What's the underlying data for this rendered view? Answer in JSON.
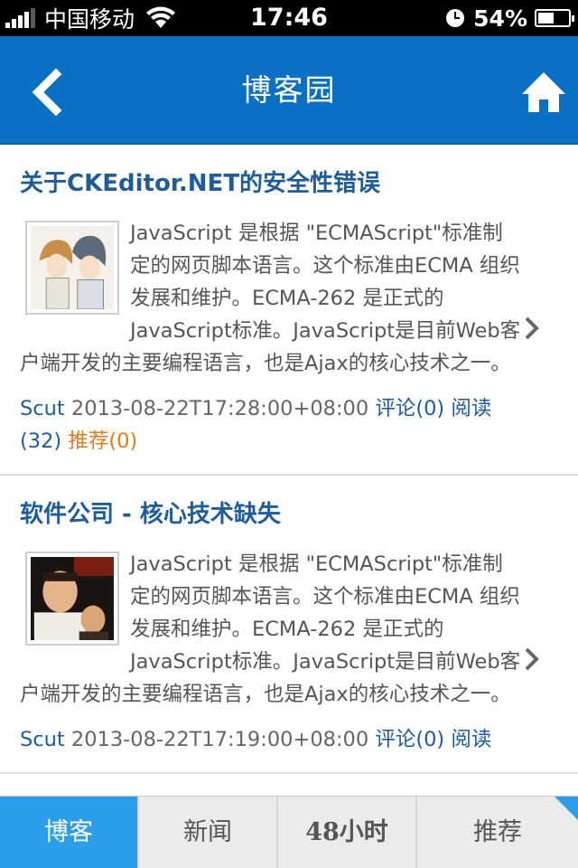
{
  "status_bar": {
    "carrier": "中国移动",
    "time": "17:46",
    "battery_percent": "54%",
    "battery_level": 0.54
  },
  "nav": {
    "title": "博客园",
    "back_icon": "chevron-left-icon",
    "home_icon": "home-icon"
  },
  "posts": [
    {
      "title": "关于CKEditor.NET的安全性错误",
      "summary": "JavaScript 是根据 \"ECMAScript\"标准制定的网页脚本语言。这个标准由ECMA 组织发展和维护。ECMA-262 是正式的 JavaScript标准。JavaScript是目前Web客户端开发的主要编程语言，也是Ajax的核心技术之一。",
      "author": "Scut",
      "date": "2013-08-22T17:28:00+08:00",
      "comments": "评论(0)",
      "reads": "阅读(32)",
      "recommend": "推荐(0)",
      "thumb_icon": "anime-avatar-thumbnail"
    },
    {
      "title": "软件公司 - 核心技术缺失",
      "summary": "JavaScript 是根据 \"ECMAScript\"标准制定的网页脚本语言。这个标准由ECMA 组织发展和维护。ECMA-262 是正式的 JavaScript标准。JavaScript是目前Web客户端开发的主要编程语言，也是Ajax的核心技术之一。",
      "author": "Scut",
      "date": "2013-08-22T17:19:00+08:00",
      "comments": "评论(0)",
      "reads": "阅读",
      "recommend": "",
      "thumb_icon": "photo-avatar-thumbnail"
    }
  ],
  "tabs": [
    {
      "label": "博客",
      "active": true
    },
    {
      "label": "新闻",
      "active": false
    },
    {
      "label": "48小时",
      "active": false
    },
    {
      "label": "推荐",
      "active": false
    }
  ],
  "colors": {
    "nav_bg": "#0a70c4",
    "title_blue": "#1f5c9c",
    "recommend_orange": "#e07b1a",
    "tab_active": "#2a9ee8"
  }
}
